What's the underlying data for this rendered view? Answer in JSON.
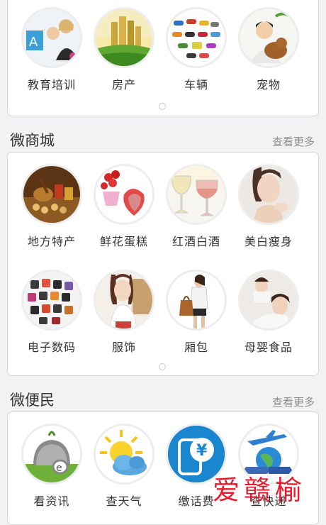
{
  "top_section": {
    "items": [
      {
        "label": "教育培训",
        "icon": "education-training-photo"
      },
      {
        "label": "房产",
        "icon": "real-estate-photo"
      },
      {
        "label": "车辆",
        "icon": "vehicles-photo"
      },
      {
        "label": "宠物",
        "icon": "pets-photo"
      }
    ]
  },
  "mall": {
    "title": "微商城",
    "more": "查看更多",
    "items": [
      {
        "label": "地方特产",
        "icon": "local-specialty-photo"
      },
      {
        "label": "鲜花蛋糕",
        "icon": "flowers-cake-photo"
      },
      {
        "label": "红酒白酒",
        "icon": "wine-photo"
      },
      {
        "label": "美白瘦身",
        "icon": "beauty-photo"
      },
      {
        "label": "电子数码",
        "icon": "electronics-photo"
      },
      {
        "label": "服饰",
        "icon": "clothing-photo"
      },
      {
        "label": "厢包",
        "icon": "handbag-photo"
      },
      {
        "label": "母婴食品",
        "icon": "mother-baby-photo"
      }
    ]
  },
  "services": {
    "title": "微便民",
    "more": "查看更多",
    "items": [
      {
        "label": "看资讯",
        "icon": "news-icon"
      },
      {
        "label": "查天气",
        "icon": "weather-icon"
      },
      {
        "label": "缴话费",
        "icon": "phone-bill-icon"
      },
      {
        "label": "查快递",
        "icon": "express-icon"
      }
    ]
  },
  "watermark": "爱赣榆",
  "colors": {
    "background": "#f2f2f4",
    "card": "#ffffff",
    "text": "#333333",
    "more": "#8e8e8e",
    "watermark": "#e8192c"
  }
}
